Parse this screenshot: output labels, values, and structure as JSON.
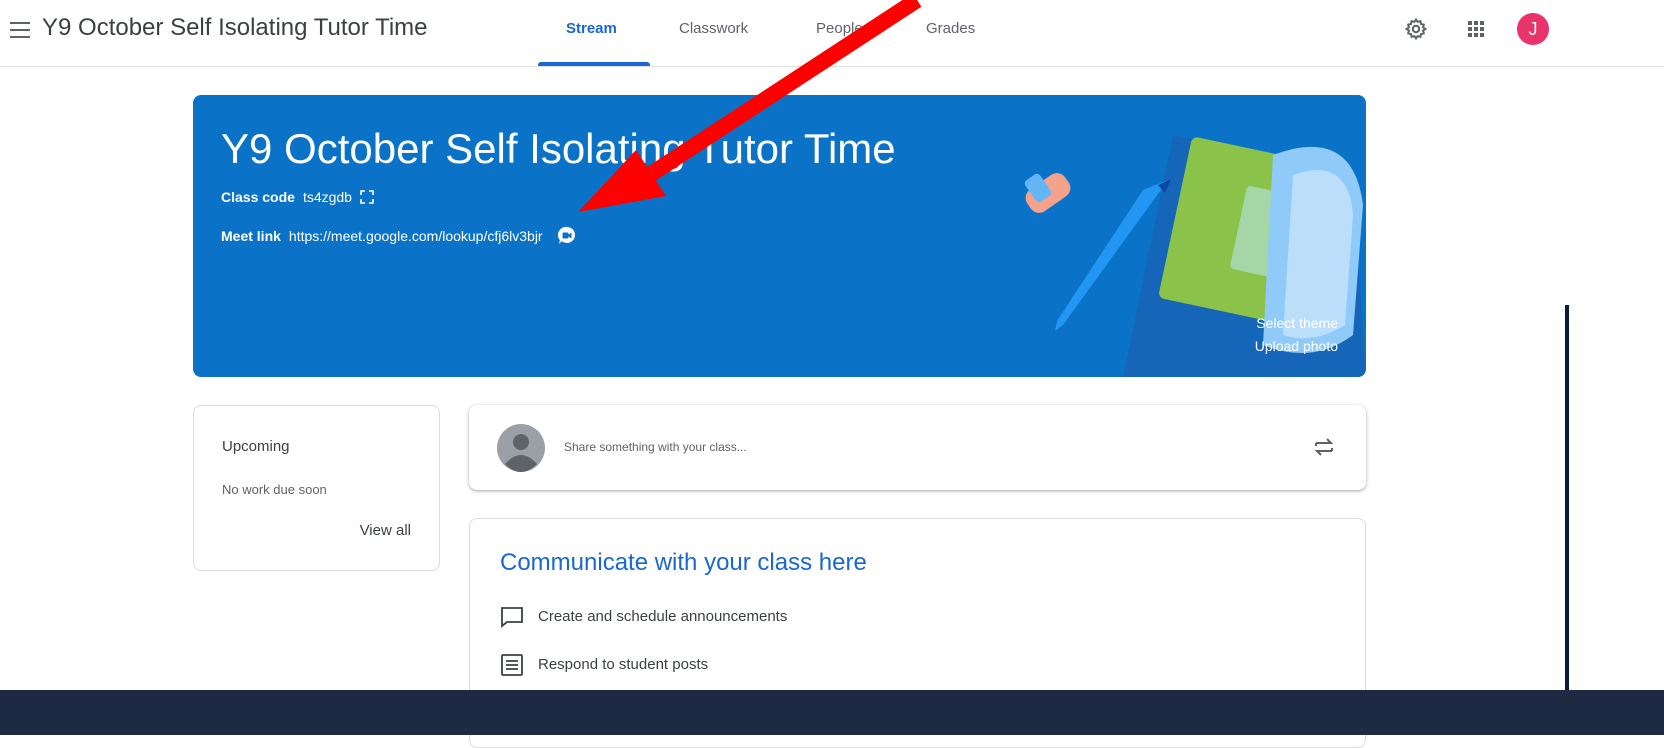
{
  "app": {
    "title": "Y9 October Self Isolating Tutor Time"
  },
  "tabs": [
    {
      "label": "Stream",
      "active": true
    },
    {
      "label": "Classwork",
      "active": false
    },
    {
      "label": "People",
      "active": false
    },
    {
      "label": "Grades",
      "active": false
    }
  ],
  "account": {
    "avatar_letter": "J",
    "avatar_color": "#e8336b"
  },
  "banner": {
    "title": "Y9 October Self Isolating Tutor Time",
    "class_code_label": "Class code",
    "class_code": "ts4zgdb",
    "meet_link_label": "Meet link",
    "meet_link": "https://meet.google.com/lookup/cfj6lv3bjr",
    "select_theme": "Select theme",
    "upload_photo": "Upload photo",
    "color": "#0b73c7"
  },
  "upcoming": {
    "title": "Upcoming",
    "empty_text": "No work due soon",
    "view_all": "View all"
  },
  "share": {
    "placeholder": "Share something with your class..."
  },
  "communicate": {
    "title": "Communicate with your class here",
    "items": [
      {
        "icon": "announcement-icon",
        "label": "Create and schedule announcements"
      },
      {
        "icon": "posts-icon",
        "label": "Respond to student posts"
      }
    ]
  },
  "colors": {
    "accent": "#1967d2",
    "annotation_arrow": "#ff0000"
  }
}
